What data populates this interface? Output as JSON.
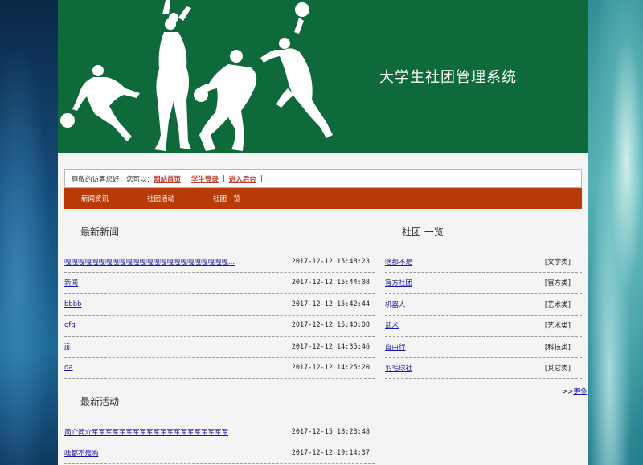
{
  "banner": {
    "title": "大学生社团管理系统"
  },
  "topbar": {
    "greeting": "尊敬的访客您好，您可以：",
    "links": [
      "网站首页",
      "学生登录",
      "进入后台"
    ]
  },
  "nav": {
    "items": [
      "新闻资讯",
      "社团活动",
      "社团一览"
    ]
  },
  "news": {
    "title": "最新新闻",
    "items": [
      {
        "title": "嘎嘎嘎嘎嘎嘎嘎嘎嘎嘎嘎嘎嘎嘎嘎嘎嘎嘎嘎嘎嘎嘎嘎嘎...",
        "date": "2017-12-12 15:48:23"
      },
      {
        "title": "新闻",
        "date": "2017-12-12 15:44:08"
      },
      {
        "title": "bbbb",
        "date": "2017-12-12 15:42:44"
      },
      {
        "title": "gfg",
        "date": "2017-12-12 15:40:08"
      },
      {
        "title": "jjj",
        "date": "2017-12-12 14:35:46"
      },
      {
        "title": "da",
        "date": "2017-12-12 14:25:20"
      }
    ]
  },
  "activities": {
    "title": "最新活动",
    "items": [
      {
        "title": "简介简介军军军军军军军军军军军军军军军军军军军军",
        "date": "2017-12-15 18:23:48"
      },
      {
        "title": "啥都不是哟",
        "date": "2017-12-12 19:14:37"
      }
    ]
  },
  "clubs": {
    "title": "社团 一览",
    "items": [
      {
        "name": "啥都不是",
        "category": "[文学类]"
      },
      {
        "name": "官方社团",
        "category": "[官方类]"
      },
      {
        "name": "机器人",
        "category": "[艺术类]"
      },
      {
        "name": "武术",
        "category": "[艺术类]"
      },
      {
        "name": "自由行",
        "category": "[科技类]"
      },
      {
        "name": "羽毛球社",
        "category": "[其它类]"
      }
    ],
    "more_prefix": ">>",
    "more_label": "更多"
  }
}
